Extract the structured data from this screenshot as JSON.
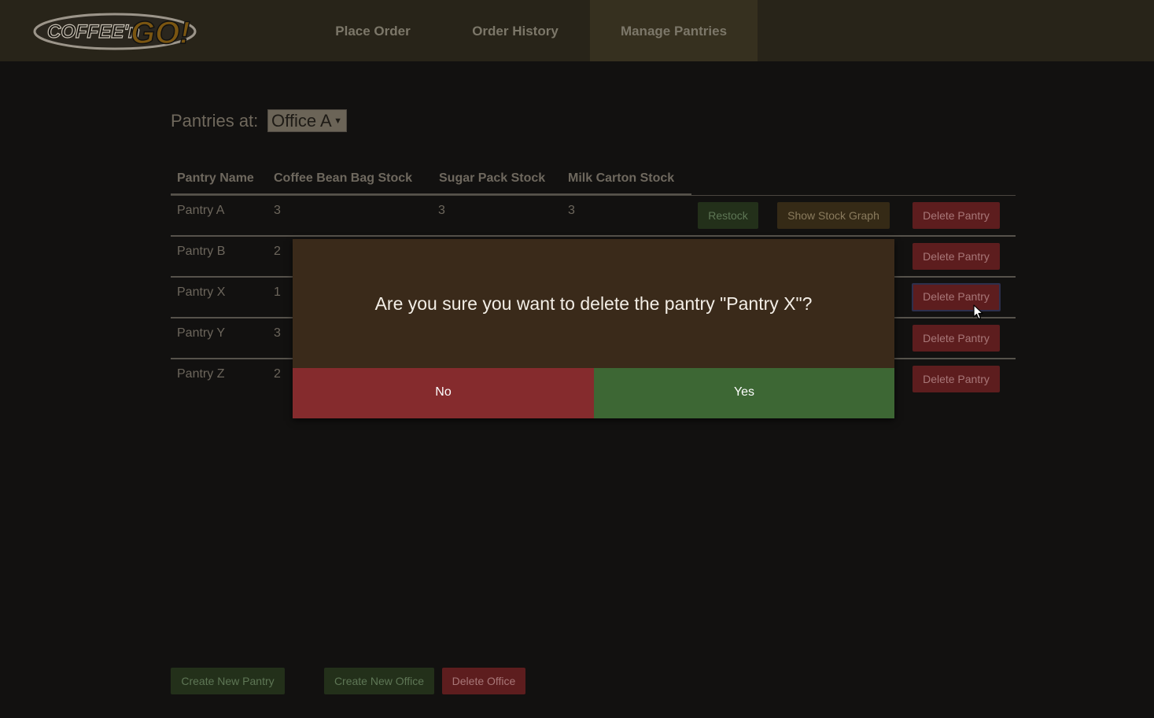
{
  "header": {
    "logo_text": "COFFEE'n GO!",
    "nav": [
      {
        "label": "Place Order",
        "active": false
      },
      {
        "label": "Order History",
        "active": false
      },
      {
        "label": "Manage Pantries",
        "active": true
      }
    ]
  },
  "office_selector": {
    "label": "Pantries at:",
    "selected": "Office A"
  },
  "table": {
    "columns": [
      "Pantry Name",
      "Coffee Bean Bag Stock",
      "Sugar Pack Stock",
      "Milk Carton Stock"
    ],
    "rows": [
      {
        "name": "Pantry A",
        "coffee": "3",
        "sugar": "3",
        "milk": "3"
      },
      {
        "name": "Pantry B",
        "coffee": "2"
      },
      {
        "name": "Pantry X",
        "coffee": "1"
      },
      {
        "name": "Pantry Y",
        "coffee": "3"
      },
      {
        "name": "Pantry Z",
        "coffee": "2"
      }
    ],
    "restock_label": "Restock",
    "graph_label": "Show Stock Graph",
    "delete_label": "Delete Pantry"
  },
  "footer": {
    "create_pantry": "Create New Pantry",
    "create_office": "Create New Office",
    "delete_office": "Delete Office"
  },
  "modal": {
    "message": "Are you sure you want to delete the pantry \"Pantry X\"?",
    "no_label": "No",
    "yes_label": "Yes"
  },
  "colors": {
    "background": "#121110",
    "header": "#282419",
    "modal": "#3a2a1a",
    "no": "#852b2d",
    "yes": "#3d6734"
  }
}
